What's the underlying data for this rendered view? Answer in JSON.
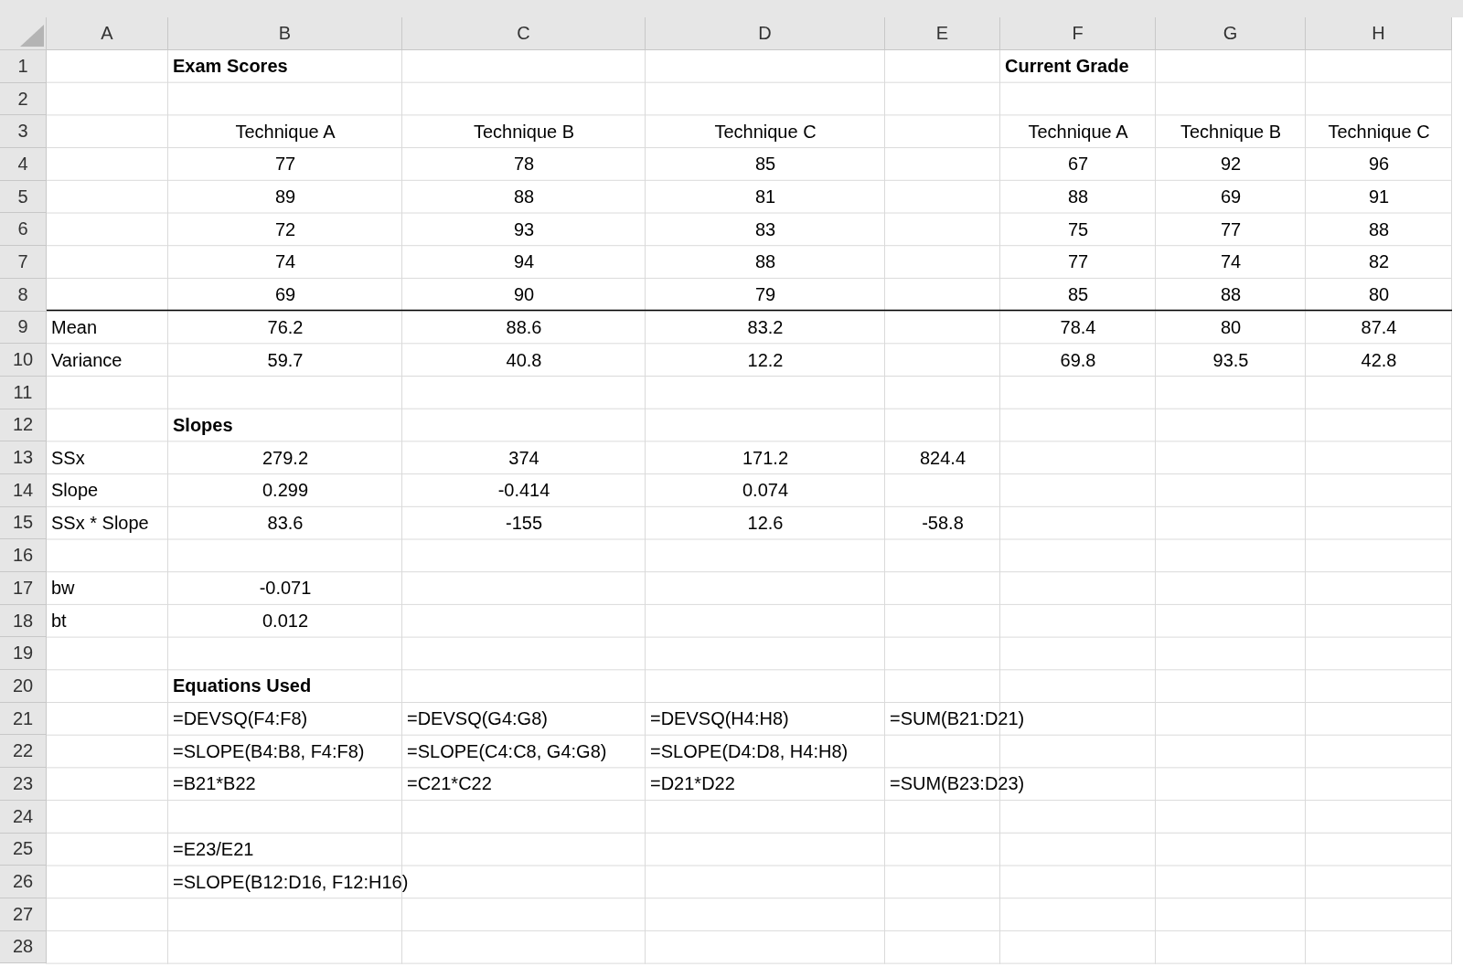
{
  "columns": [
    {
      "label": "A",
      "selected": false
    },
    {
      "label": "B",
      "selected": false
    },
    {
      "label": "C",
      "selected": false
    },
    {
      "label": "D",
      "selected": false
    },
    {
      "label": "E",
      "selected": false
    },
    {
      "label": "F",
      "selected": false
    },
    {
      "label": "G",
      "selected": false
    },
    {
      "label": "H",
      "selected": false
    }
  ],
  "rows": [
    {
      "number": "1",
      "border_bottom": false,
      "cells": [
        null,
        {
          "text": "Exam Scores",
          "kind": "heading"
        },
        null,
        null,
        null,
        {
          "text": "Current Grade",
          "kind": "heading"
        },
        null,
        null
      ]
    },
    {
      "number": "2",
      "border_bottom": false,
      "cells": [
        null,
        null,
        null,
        null,
        null,
        null,
        null,
        null
      ]
    },
    {
      "number": "3",
      "border_bottom": false,
      "cells": [
        null,
        {
          "text": "Technique A",
          "kind": "value"
        },
        {
          "text": "Technique B",
          "kind": "value"
        },
        {
          "text": "Technique C",
          "kind": "value"
        },
        null,
        {
          "text": "Technique A",
          "kind": "value"
        },
        {
          "text": "Technique B",
          "kind": "value"
        },
        {
          "text": "Technique C",
          "kind": "value"
        }
      ]
    },
    {
      "number": "4",
      "border_bottom": false,
      "cells": [
        null,
        {
          "text": "77",
          "kind": "value"
        },
        {
          "text": "78",
          "kind": "value"
        },
        {
          "text": "85",
          "kind": "value"
        },
        null,
        {
          "text": "67",
          "kind": "value"
        },
        {
          "text": "92",
          "kind": "value"
        },
        {
          "text": "96",
          "kind": "value"
        }
      ]
    },
    {
      "number": "5",
      "border_bottom": false,
      "cells": [
        null,
        {
          "text": "89",
          "kind": "value"
        },
        {
          "text": "88",
          "kind": "value"
        },
        {
          "text": "81",
          "kind": "value"
        },
        null,
        {
          "text": "88",
          "kind": "value"
        },
        {
          "text": "69",
          "kind": "value"
        },
        {
          "text": "91",
          "kind": "value"
        }
      ]
    },
    {
      "number": "6",
      "border_bottom": false,
      "cells": [
        null,
        {
          "text": "72",
          "kind": "value"
        },
        {
          "text": "93",
          "kind": "value"
        },
        {
          "text": "83",
          "kind": "value"
        },
        null,
        {
          "text": "75",
          "kind": "value"
        },
        {
          "text": "77",
          "kind": "value"
        },
        {
          "text": "88",
          "kind": "value"
        }
      ]
    },
    {
      "number": "7",
      "border_bottom": false,
      "cells": [
        null,
        {
          "text": "74",
          "kind": "value"
        },
        {
          "text": "94",
          "kind": "value"
        },
        {
          "text": "88",
          "kind": "value"
        },
        null,
        {
          "text": "77",
          "kind": "value"
        },
        {
          "text": "74",
          "kind": "value"
        },
        {
          "text": "82",
          "kind": "value"
        }
      ]
    },
    {
      "number": "8",
      "border_bottom": true,
      "cells": [
        null,
        {
          "text": "69",
          "kind": "value"
        },
        {
          "text": "90",
          "kind": "value"
        },
        {
          "text": "79",
          "kind": "value"
        },
        null,
        {
          "text": "85",
          "kind": "value"
        },
        {
          "text": "88",
          "kind": "value"
        },
        {
          "text": "80",
          "kind": "value"
        }
      ]
    },
    {
      "number": "9",
      "border_bottom": false,
      "cells": [
        {
          "text": "Mean",
          "kind": "label"
        },
        {
          "text": "76.2",
          "kind": "value"
        },
        {
          "text": "88.6",
          "kind": "value"
        },
        {
          "text": "83.2",
          "kind": "value"
        },
        null,
        {
          "text": "78.4",
          "kind": "value"
        },
        {
          "text": "80",
          "kind": "value"
        },
        {
          "text": "87.4",
          "kind": "value"
        }
      ]
    },
    {
      "number": "10",
      "border_bottom": false,
      "cells": [
        {
          "text": "Variance",
          "kind": "label"
        },
        {
          "text": "59.7",
          "kind": "value"
        },
        {
          "text": "40.8",
          "kind": "value"
        },
        {
          "text": "12.2",
          "kind": "value"
        },
        null,
        {
          "text": "69.8",
          "kind": "value"
        },
        {
          "text": "93.5",
          "kind": "value"
        },
        {
          "text": "42.8",
          "kind": "value"
        }
      ]
    },
    {
      "number": "11",
      "border_bottom": false,
      "cells": [
        null,
        null,
        null,
        null,
        null,
        null,
        null,
        null
      ]
    },
    {
      "number": "12",
      "border_bottom": false,
      "cells": [
        null,
        {
          "text": "Slopes",
          "kind": "heading"
        },
        null,
        null,
        null,
        null,
        null,
        null
      ]
    },
    {
      "number": "13",
      "border_bottom": false,
      "cells": [
        {
          "text": "SSx",
          "kind": "label"
        },
        {
          "text": "279.2",
          "kind": "value"
        },
        {
          "text": "374",
          "kind": "value"
        },
        {
          "text": "171.2",
          "kind": "value"
        },
        {
          "text": "824.4",
          "kind": "value"
        },
        null,
        null,
        null
      ]
    },
    {
      "number": "14",
      "border_bottom": false,
      "cells": [
        {
          "text": "Slope",
          "kind": "label"
        },
        {
          "text": "0.299",
          "kind": "value"
        },
        {
          "text": "-0.414",
          "kind": "value"
        },
        {
          "text": "0.074",
          "kind": "value"
        },
        null,
        null,
        null,
        null
      ]
    },
    {
      "number": "15",
      "border_bottom": false,
      "cells": [
        {
          "text": "SSx * Slope",
          "kind": "label"
        },
        {
          "text": "83.6",
          "kind": "value"
        },
        {
          "text": "-155",
          "kind": "value"
        },
        {
          "text": "12.6",
          "kind": "value"
        },
        {
          "text": "-58.8",
          "kind": "value"
        },
        null,
        null,
        null
      ]
    },
    {
      "number": "16",
      "border_bottom": false,
      "cells": [
        null,
        null,
        null,
        null,
        null,
        null,
        null,
        null
      ]
    },
    {
      "number": "17",
      "border_bottom": false,
      "cells": [
        {
          "text": "bw",
          "kind": "label"
        },
        {
          "text": "-0.071",
          "kind": "value"
        },
        null,
        null,
        null,
        null,
        null,
        null
      ]
    },
    {
      "number": "18",
      "border_bottom": false,
      "cells": [
        {
          "text": "bt",
          "kind": "label"
        },
        {
          "text": "0.012",
          "kind": "value"
        },
        null,
        null,
        null,
        null,
        null,
        null
      ]
    },
    {
      "number": "19",
      "border_bottom": false,
      "cells": [
        null,
        null,
        null,
        null,
        null,
        null,
        null,
        null
      ]
    },
    {
      "number": "20",
      "border_bottom": false,
      "cells": [
        null,
        {
          "text": "Equations Used",
          "kind": "heading"
        },
        null,
        null,
        null,
        null,
        null,
        null
      ]
    },
    {
      "number": "21",
      "border_bottom": false,
      "cells": [
        null,
        {
          "text": "=DEVSQ(F4:F8)",
          "kind": "label"
        },
        {
          "text": "=DEVSQ(G4:G8)",
          "kind": "label"
        },
        {
          "text": "=DEVSQ(H4:H8)",
          "kind": "label"
        },
        {
          "text": "=SUM(B21:D21)",
          "kind": "label"
        },
        null,
        null,
        null
      ]
    },
    {
      "number": "22",
      "border_bottom": false,
      "cells": [
        null,
        {
          "text": "=SLOPE(B4:B8, F4:F8)",
          "kind": "label"
        },
        {
          "text": "=SLOPE(C4:C8, G4:G8)",
          "kind": "label"
        },
        {
          "text": "=SLOPE(D4:D8, H4:H8)",
          "kind": "label"
        },
        null,
        null,
        null,
        null
      ]
    },
    {
      "number": "23",
      "border_bottom": false,
      "cells": [
        null,
        {
          "text": "=B21*B22",
          "kind": "label"
        },
        {
          "text": "=C21*C22",
          "kind": "label"
        },
        {
          "text": "=D21*D22",
          "kind": "label"
        },
        {
          "text": "=SUM(B23:D23)",
          "kind": "label"
        },
        null,
        null,
        null
      ]
    },
    {
      "number": "24",
      "border_bottom": false,
      "cells": [
        null,
        null,
        null,
        null,
        null,
        null,
        null,
        null
      ]
    },
    {
      "number": "25",
      "border_bottom": false,
      "cells": [
        null,
        {
          "text": "=E23/E21",
          "kind": "label"
        },
        null,
        null,
        null,
        null,
        null,
        null
      ]
    },
    {
      "number": "26",
      "border_bottom": false,
      "cells": [
        null,
        {
          "text": "=SLOPE(B12:D16, F12:H16)",
          "kind": "label"
        },
        null,
        null,
        null,
        null,
        null,
        null
      ]
    },
    {
      "number": "27",
      "border_bottom": false,
      "cells": [
        null,
        null,
        null,
        null,
        null,
        null,
        null,
        null
      ]
    },
    {
      "number": "28",
      "border_bottom": false,
      "cells": [
        null,
        null,
        null,
        null,
        null,
        null,
        null,
        null
      ]
    }
  ]
}
